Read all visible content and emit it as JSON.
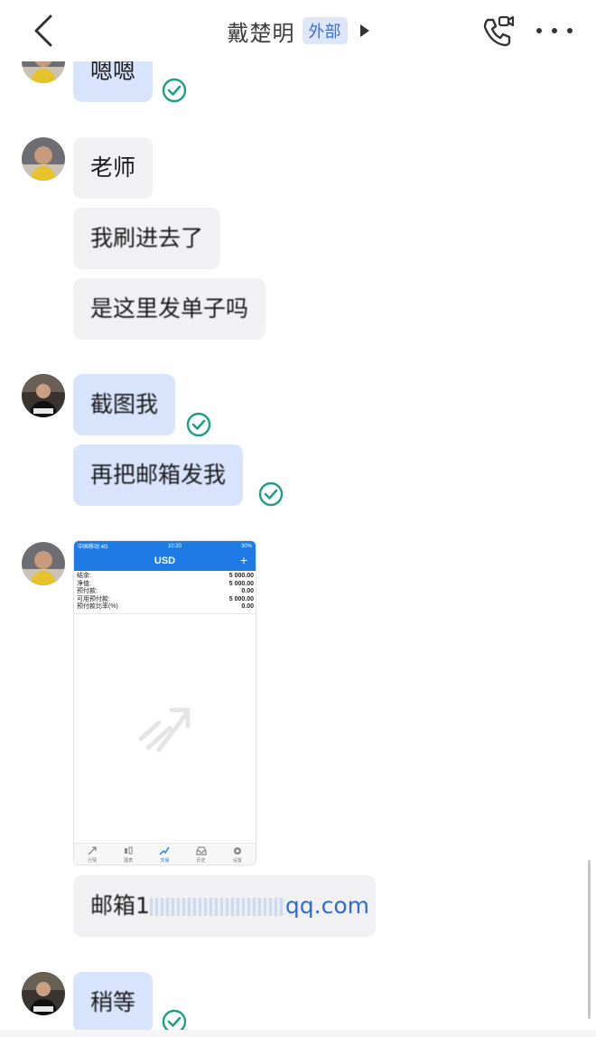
{
  "header": {
    "title": "戴楚明",
    "external_tag": "外部"
  },
  "messages": [
    {
      "text": "嗯嗯",
      "side": "sent"
    },
    {
      "text": "老师",
      "side": "recv"
    },
    {
      "text": "我刷进去了",
      "side": "recv"
    },
    {
      "text": "是这里发单子吗",
      "side": "recv"
    },
    {
      "text": "截图我",
      "side": "sent"
    },
    {
      "text": "再把邮箱发我",
      "side": "sent"
    },
    {
      "text_prefix": "邮箱1",
      "text_suffix": "qq.com",
      "side": "recv"
    },
    {
      "text": "稍等",
      "side": "sent"
    }
  ],
  "screenshot": {
    "status_carrier": "中国移动 4G",
    "status_time": "10:20",
    "status_battery": "30%",
    "currency": "USD",
    "plus": "+",
    "rows": [
      {
        "label": "结余:",
        "value": "5 000.00"
      },
      {
        "label": "净值:",
        "value": "5 000.00"
      },
      {
        "label": "预付款:",
        "value": "0.00"
      },
      {
        "label": "可用预付款:",
        "value": "5 000.00"
      },
      {
        "label": "预付款比率(%)",
        "value": "0.00"
      }
    ],
    "tabs": [
      {
        "label": "行情",
        "icon": "quotes-icon"
      },
      {
        "label": "图表",
        "icon": "candles-icon"
      },
      {
        "label": "交易",
        "icon": "trade-icon",
        "active": true
      },
      {
        "label": "历史",
        "icon": "history-icon"
      },
      {
        "label": "设置",
        "icon": "gear-icon"
      }
    ]
  },
  "colors": {
    "sent_bubble": "#d7e4fb",
    "recv_bubble": "#f1f1f3",
    "check": "#1f9e86",
    "accent": "#1e7be6"
  }
}
